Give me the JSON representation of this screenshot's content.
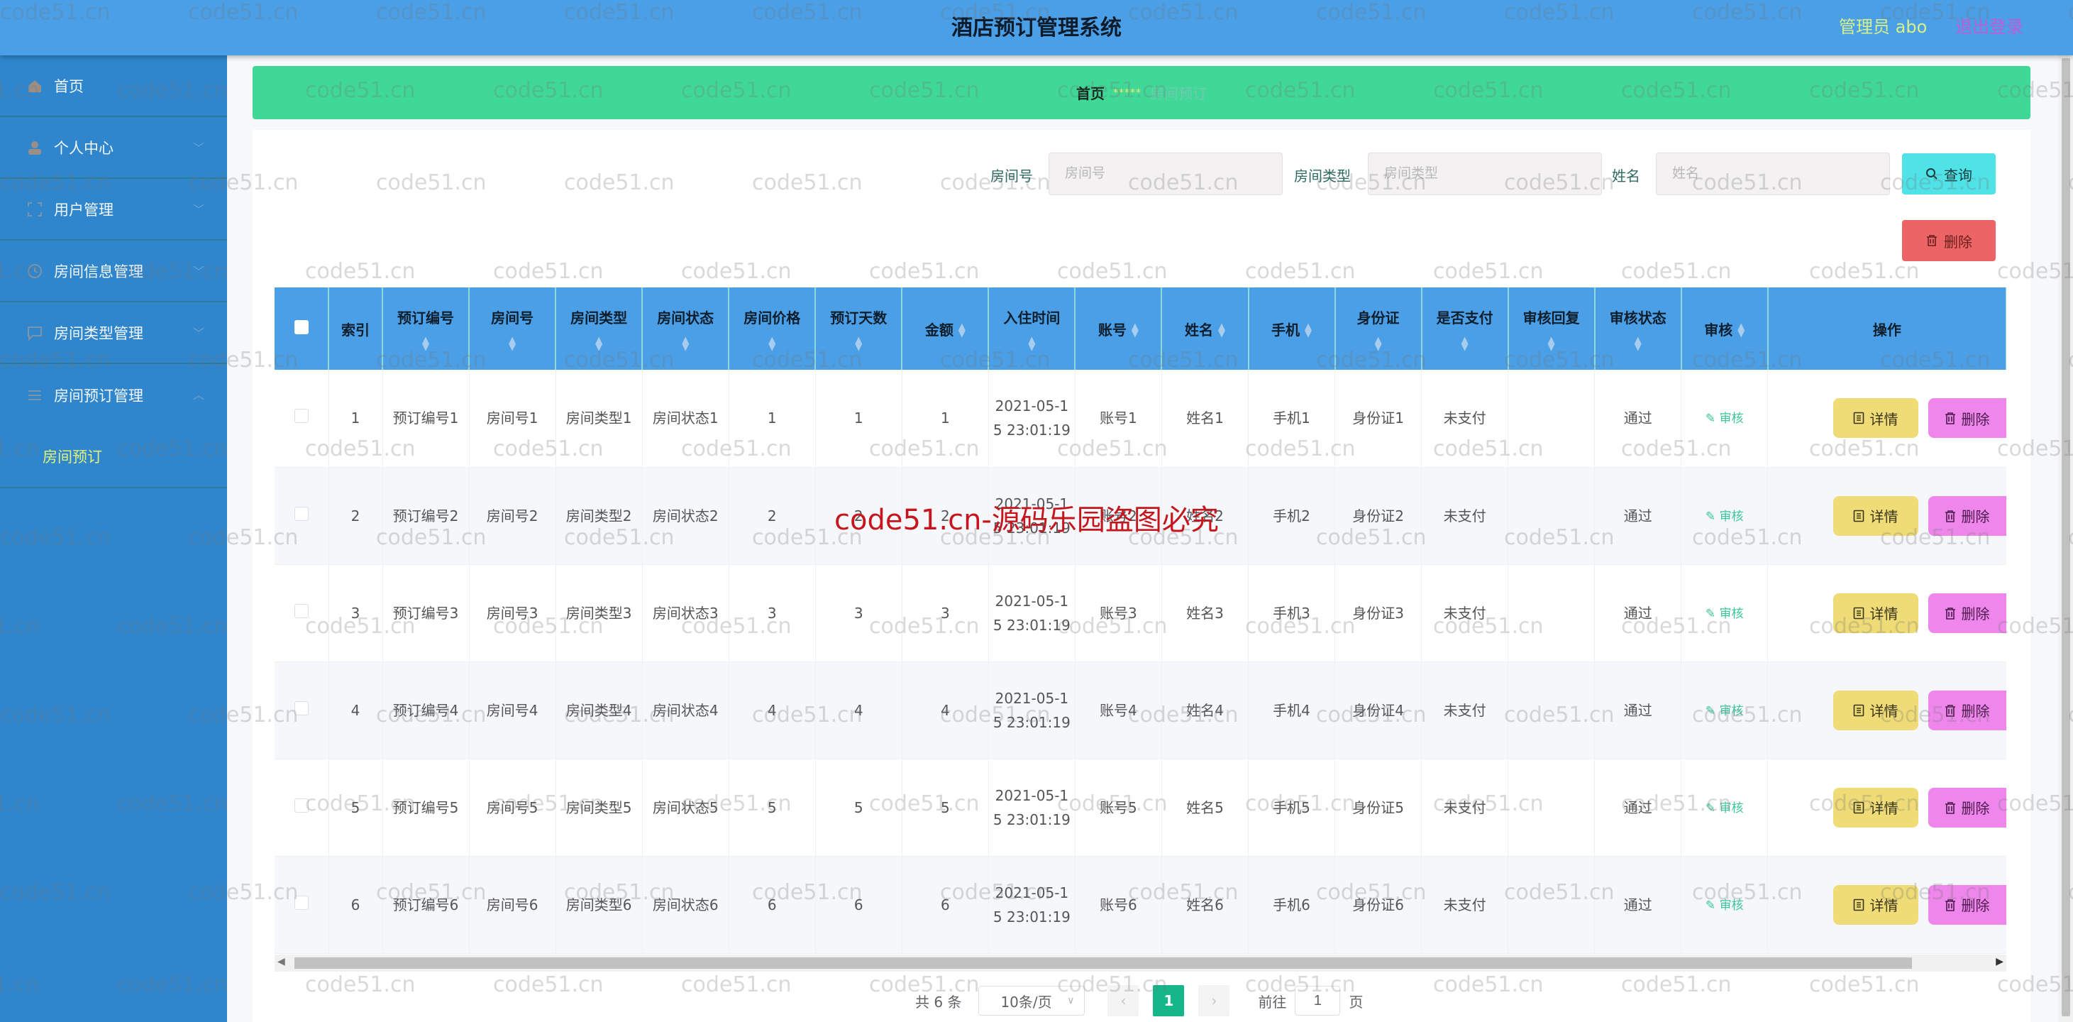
{
  "header": {
    "title": "酒店预订管理系统",
    "user": "管理员 abo",
    "logout": "退出登录"
  },
  "sidebar": {
    "items": [
      {
        "label": "首页",
        "icon": "home-icon",
        "expandable": false
      },
      {
        "label": "个人中心",
        "icon": "user-icon",
        "expandable": true
      },
      {
        "label": "用户管理",
        "icon": "scan-icon",
        "expandable": true
      },
      {
        "label": "房间信息管理",
        "icon": "clock-icon",
        "expandable": true
      },
      {
        "label": "房间类型管理",
        "icon": "chat-icon",
        "expandable": true
      },
      {
        "label": "房间预订管理",
        "icon": "sliders-icon",
        "expandable": true,
        "expanded": true
      }
    ],
    "submenu": {
      "label": "房间预订",
      "active": true
    }
  },
  "breadcrumb": {
    "home": "首页",
    "separator": "*****",
    "current": "房间预订"
  },
  "search": {
    "fields": [
      {
        "label": "房间号",
        "placeholder": "房间号",
        "value": ""
      },
      {
        "label": "房间类型",
        "placeholder": "房间类型",
        "value": ""
      },
      {
        "label": "姓名",
        "placeholder": "姓名",
        "value": ""
      }
    ],
    "query_label": "查询",
    "delete_label": "删除"
  },
  "table": {
    "columns": [
      "",
      "索引",
      "预订编号",
      "房间号",
      "房间类型",
      "房间状态",
      "房间价格",
      "预订天数",
      "金额",
      "入住时间",
      "账号",
      "姓名",
      "手机",
      "身份证",
      "是否支付",
      "审核回复",
      "审核状态",
      "审核",
      "操作"
    ],
    "rows": [
      {
        "index": "1",
        "booking_no": "预订编号1",
        "room_no": "房间号1",
        "room_type": "房间类型1",
        "room_status": "房间状态1",
        "price": "1",
        "days": "1",
        "amount": "1",
        "checkin": "2021-05-15 23:01:19",
        "account": "账号1",
        "name": "姓名1",
        "phone": "手机1",
        "id_card": "身份证1",
        "paid": "未支付",
        "audit_reply": "",
        "audit_status": "通过"
      },
      {
        "index": "2",
        "booking_no": "预订编号2",
        "room_no": "房间号2",
        "room_type": "房间类型2",
        "room_status": "房间状态2",
        "price": "2",
        "days": "2",
        "amount": "2",
        "checkin": "2021-05-15 23:01:19",
        "account": "账号2",
        "name": "姓名2",
        "phone": "手机2",
        "id_card": "身份证2",
        "paid": "未支付",
        "audit_reply": "",
        "audit_status": "通过"
      },
      {
        "index": "3",
        "booking_no": "预订编号3",
        "room_no": "房间号3",
        "room_type": "房间类型3",
        "room_status": "房间状态3",
        "price": "3",
        "days": "3",
        "amount": "3",
        "checkin": "2021-05-15 23:01:19",
        "account": "账号3",
        "name": "姓名3",
        "phone": "手机3",
        "id_card": "身份证3",
        "paid": "未支付",
        "audit_reply": "",
        "audit_status": "通过"
      },
      {
        "index": "4",
        "booking_no": "预订编号4",
        "room_no": "房间号4",
        "room_type": "房间类型4",
        "room_status": "房间状态4",
        "price": "4",
        "days": "4",
        "amount": "4",
        "checkin": "2021-05-15 23:01:19",
        "account": "账号4",
        "name": "姓名4",
        "phone": "手机4",
        "id_card": "身份证4",
        "paid": "未支付",
        "audit_reply": "",
        "audit_status": "通过"
      },
      {
        "index": "5",
        "booking_no": "预订编号5",
        "room_no": "房间号5",
        "room_type": "房间类型5",
        "room_status": "房间状态5",
        "price": "5",
        "days": "5",
        "amount": "5",
        "checkin": "2021-05-15 23:01:19",
        "account": "账号5",
        "name": "姓名5",
        "phone": "手机5",
        "id_card": "身份证5",
        "paid": "未支付",
        "audit_reply": "",
        "audit_status": "通过"
      },
      {
        "index": "6",
        "booking_no": "预订编号6",
        "room_no": "房间号6",
        "room_type": "房间类型6",
        "room_status": "房间状态6",
        "price": "6",
        "days": "6",
        "amount": "6",
        "checkin": "2021-05-15 23:01:19",
        "account": "账号6",
        "name": "姓名6",
        "phone": "手机6",
        "id_card": "身份证6",
        "paid": "未支付",
        "audit_reply": "",
        "audit_status": "通过"
      }
    ],
    "audit_link": "审核",
    "detail_label": "详情",
    "row_delete_label": "删除"
  },
  "pagination": {
    "total": "共 6 条",
    "page_size": "10条/页",
    "current_page": "1",
    "goto_prefix": "前往",
    "goto_value": "1",
    "goto_suffix": "页"
  },
  "watermarks": {
    "repeat": "code51.cn",
    "center": "code51.cn-源码乐园盗图必究"
  },
  "colors": {
    "header_bg": "#4a9fe6",
    "sidebar_bg": "#2f86cd",
    "breadcrumb_bg": "#3fd897",
    "query_button": "#4fe3e8",
    "delete_button": "#ec6465",
    "detail_button": "#efdc76",
    "row_delete_button": "#ee86ec",
    "pager_active": "#16b68a"
  }
}
